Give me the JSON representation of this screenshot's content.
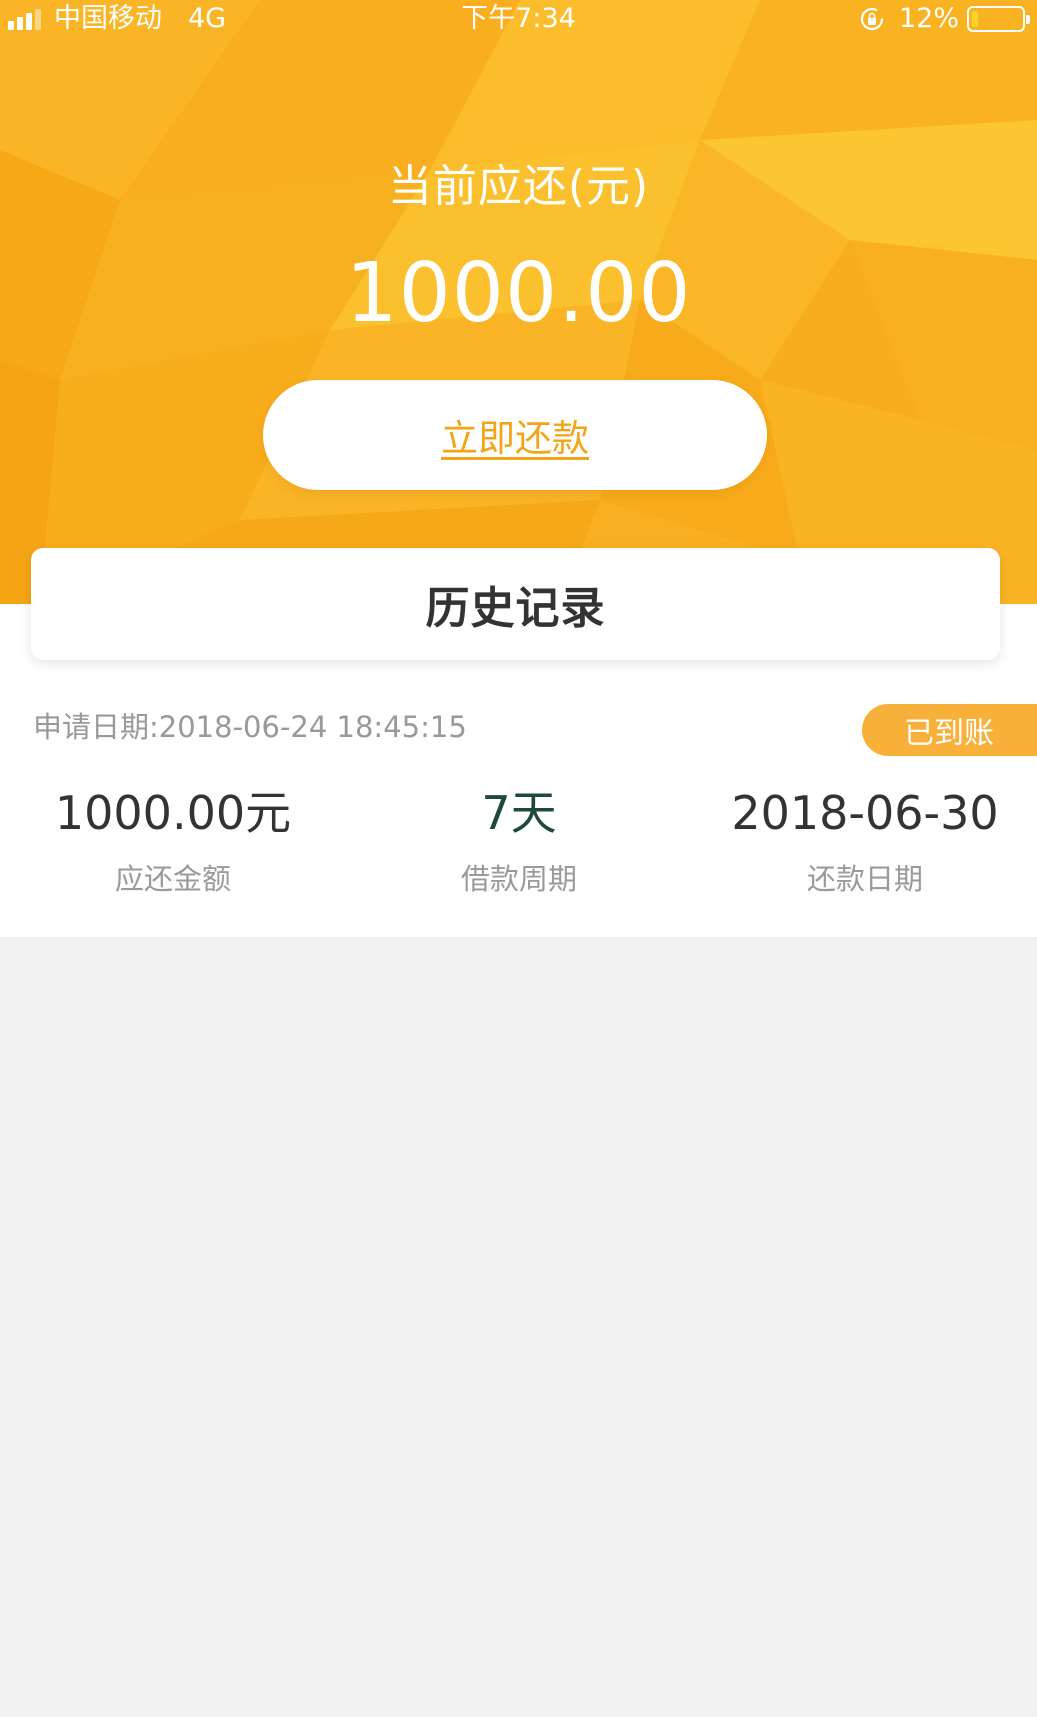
{
  "status_bar": {
    "carrier": "中国移动",
    "network": "4G",
    "time": "下午7:34",
    "battery_percent": "12%",
    "battery_level": 0.12,
    "icons": [
      "signal-icon",
      "rotation-lock-icon",
      "battery-icon"
    ]
  },
  "hero": {
    "title": "当前应还(元)",
    "amount": "1000.00",
    "repay_button_label": "立即还款",
    "background_color": "#f7ad1d",
    "accent_color": "#f1a619"
  },
  "history_tab": {
    "label": "历史记录"
  },
  "record": {
    "apply_date": "申请日期:2018-06-24 18:45:15",
    "status": "已到账",
    "status_color": "#f7b03a",
    "columns": [
      {
        "value": "1000.00元",
        "label": "应还金额"
      },
      {
        "value": "7天",
        "label": "借款周期"
      },
      {
        "value": "2018-06-30",
        "label": "还款日期"
      }
    ]
  }
}
